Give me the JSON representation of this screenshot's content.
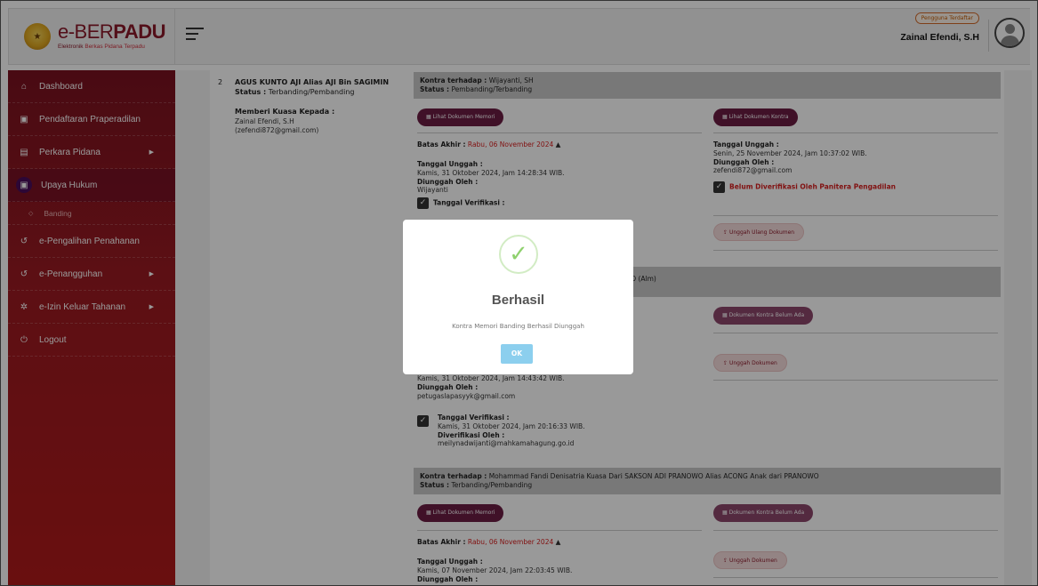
{
  "brand": {
    "title_bold": "e-BER",
    "title_accent": "PADU",
    "subtitle_a": "Elektronik ",
    "subtitle_b": "Berkas Pidana Terpadu"
  },
  "header": {
    "user_role_badge": "Pengguna Terdaftar",
    "user_name": "Zainal Efendi, S.H"
  },
  "sidebar": {
    "items": [
      {
        "label": "Dashboard",
        "icon": "home-icon"
      },
      {
        "label": "Pendaftaran Praperadilan",
        "icon": "document-icon"
      },
      {
        "label": "Perkara Pidana",
        "icon": "folder-icon"
      },
      {
        "label": "Upaya Hukum",
        "icon": "document-icon"
      },
      {
        "label": "Banding",
        "icon": "circle-dot-icon"
      },
      {
        "label": "e-Pengalihan Penahanan",
        "icon": "history-icon"
      },
      {
        "label": "e-Penangguhan",
        "icon": "history-icon"
      },
      {
        "label": "e-Izin Keluar Tahanan",
        "icon": "gear-icon"
      },
      {
        "label": "Logout",
        "icon": "power-icon"
      }
    ]
  },
  "party": {
    "number": "2",
    "name": "AGUS KUNTO AJI Alias AJI Bin SAGIMIN",
    "status_label": "Status :",
    "status_value": "Terbanding/Pembanding",
    "kuasa_title": "Memberi Kuasa Kepada :",
    "kuasa_name": "Zainal Efendi, S.H",
    "kuasa_email": "(zefendi872@gmail.com)"
  },
  "block1": {
    "kontra_label": "Kontra terhadap :",
    "kontra_value": "Wijayanti, SH",
    "status_label": "Status :",
    "status_value": "Pembanding/Terbanding",
    "btn_memori": "Lihat Dokumen Memori",
    "btn_kontra": "Lihat Dokumen Kontra",
    "batas_label": "Batas Akhir :",
    "batas_value": "Rabu, 06 November 2024",
    "unggah_label": "Tanggal Unggah :",
    "unggah_value": "Kamis, 31 Oktober 2024, Jam 14:28:34 WIB.",
    "oleh_label": "Diunggah Oleh :",
    "oleh_value": "Wijayanti",
    "verif_label": "Tanggal Verifikasi :",
    "right_unggah_label": "Tanggal Unggah :",
    "right_unggah_value": "Senin, 25 November 2024, Jam 10:37:02 WIB.",
    "right_oleh_label": "Diunggah Oleh :",
    "right_oleh_value": "zefendi872@gmail.com",
    "right_verif_text": "Belum Diverifikasi Oleh Panitera Pengadilan",
    "btn_reupload": "Unggah Ulang Dokumen"
  },
  "block2": {
    "head_partial": "NTO (Alm)",
    "btn_kontra_empty": "Dokumen Kontra Belum Ada",
    "btn_upload": "Unggah Dokumen",
    "unggah_value": "Kamis, 31 Oktober 2024, Jam 14:43:42 WIB.",
    "oleh_label": "Diunggah Oleh :",
    "oleh_value": "petugaslapasyyk@gmail.com",
    "verif_label": "Tanggal Verifikasi :",
    "verif_value": "Kamis, 31 Oktober 2024, Jam 20:16:33 WIB.",
    "verif_by_label": "Diverifikasi Oleh :",
    "verif_by_value": "meilynadwijanti@mahkamahagung.go.id"
  },
  "block3": {
    "kontra_label": "Kontra terhadap :",
    "kontra_value": "Mohammad Fandi Denisatria Kuasa Dari SAKSON ADI PRANOWO Alias ACONG Anak dari PRANOWO",
    "status_label": "Status :",
    "status_value": "Terbanding/Pembanding",
    "btn_memori": "Lihat Dokumen Memori",
    "btn_kontra_empty": "Dokumen Kontra Belum Ada",
    "btn_upload": "Unggah Dokumen",
    "batas_label": "Batas Akhir :",
    "batas_value": "Rabu, 06 November 2024",
    "unggah_label": "Tanggal Unggah :",
    "unggah_value": "Kamis, 07 November 2024, Jam 22:03:45 WIB.",
    "oleh_partial": "Diunggah Oleh :"
  },
  "modal": {
    "title": "Berhasil",
    "message": "Kontra Memori Banding Berhasil Diunggah",
    "ok_label": "OK"
  },
  "colors": {
    "brand": "#8b1a2b",
    "sidebar_top": "#7a1220",
    "sidebar_bottom": "#b01a1a",
    "button_dark": "#6b1d44",
    "deadline_red": "#d81e1e",
    "success_green": "#8fd16e",
    "ok_button": "#8ccfee"
  }
}
